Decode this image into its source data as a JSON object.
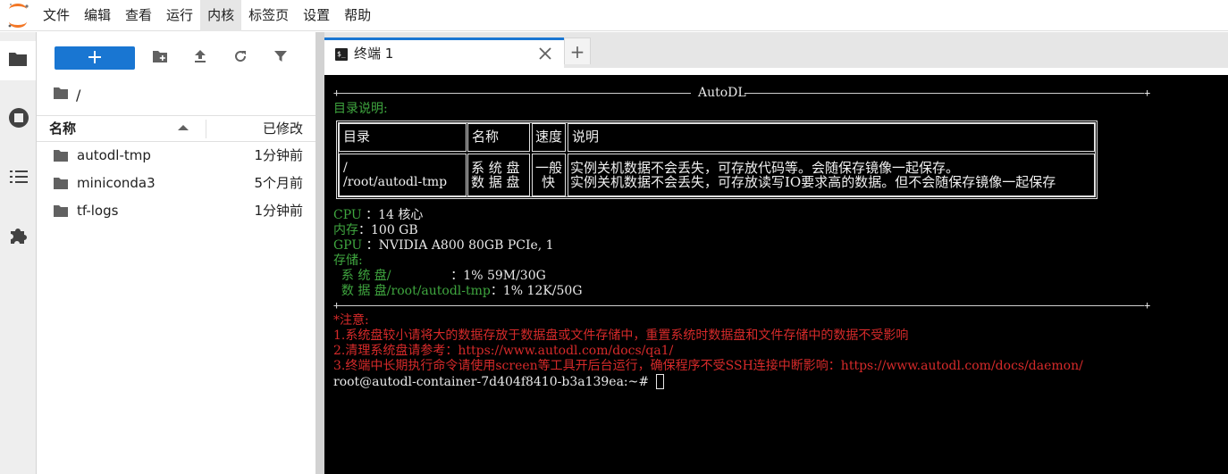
{
  "menubar": {
    "items": [
      "文件",
      "编辑",
      "查看",
      "运行",
      "内核",
      "标签页",
      "设置",
      "帮助"
    ],
    "active_index": 4
  },
  "activitybar": {
    "icons": [
      "folder-icon",
      "running-icon",
      "toc-icon",
      "extension-icon"
    ]
  },
  "filebrowser": {
    "toolbar": {
      "new_label": "+",
      "icons": [
        "new-folder-icon",
        "upload-icon",
        "refresh-icon",
        "filter-icon"
      ]
    },
    "breadcrumb": "/",
    "header": {
      "name": "名称",
      "modified": "已修改"
    },
    "files": [
      {
        "name": "autodl-tmp",
        "modified": "1分钟前"
      },
      {
        "name": "miniconda3",
        "modified": "5个月前"
      },
      {
        "name": "tf-logs",
        "modified": "1分钟前"
      }
    ]
  },
  "tabs": {
    "active": {
      "label": "终端 1",
      "icon": "terminal-icon"
    },
    "add_label": "+"
  },
  "terminal": {
    "banner": "AutoDL",
    "dir_heading": "目录说明:",
    "table": {
      "headers": [
        "目录",
        "名称",
        "速度",
        "说明"
      ],
      "row": {
        "dirs": [
          "/",
          "/root/autodl-tmp"
        ],
        "names": [
          "系 统 盘",
          "数 据 盘"
        ],
        "speed": [
          "一般",
          "快"
        ],
        "desc": [
          "实例关机数据不会丢失，可存放代码等。会随保存镜像一起保存。",
          "实例关机数据不会丢失，可存放读写IO要求高的数据。但不会随保存镜像一起保存"
        ]
      }
    },
    "specs": {
      "cpu_label": "CPU ",
      "cpu_value": "：14 核心",
      "mem_label": "内存",
      "mem_value": "：100 GB",
      "gpu_label": "GPU ",
      "gpu_value": "：NVIDIA A800 80GB PCIe, 1",
      "storage_label": "存储:",
      "sys_label": "  系 统 盘/               ",
      "sys_value": "：1% 59M/30G",
      "data_label": "  数 据 盘/root/autodl-tmp",
      "data_value": "：1% 12K/50G"
    },
    "notes": {
      "heading": "*注意:",
      "lines": [
        "1.系统盘较小请将大的数据存放于数据盘或文件存储中，重置系统时数据盘和文件存储中的数据不受影响",
        "2.清理系统盘请参考：https://www.autodl.com/docs/qa1/",
        "3.终端中长期执行命令请使用screen等工具开后台运行，确保程序不受SSH连接中断影响：https://www.autodl.com/docs/daemon/"
      ]
    },
    "prompt": "root@autodl-container-7d404f8410-b3a139ea:~# "
  },
  "colors": {
    "accent": "#1976d2",
    "terminal_bg": "#000000",
    "terminal_green": "#3fa63f",
    "terminal_red": "#d62a2a"
  }
}
